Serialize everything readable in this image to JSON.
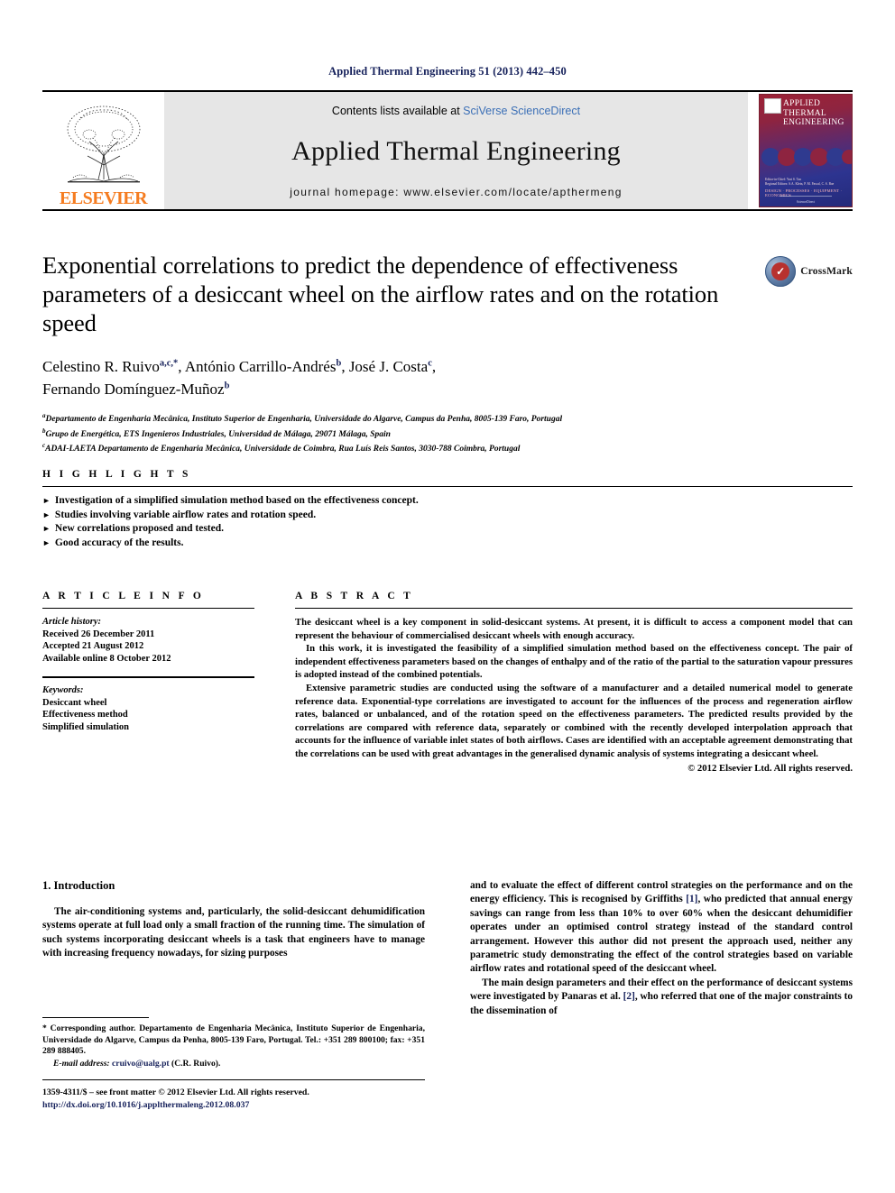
{
  "running_head": "Applied Thermal Engineering 51 (2013) 442–450",
  "masthead": {
    "contents_prefix": "Contents lists available at ",
    "contents_link": "SciVerse ScienceDirect",
    "journal_name": "Applied Thermal Engineering",
    "homepage": "journal homepage: www.elsevier.com/locate/apthermeng",
    "publisher_logo_text": "ELSEVIER",
    "cover": {
      "title_line1": "APPLIED",
      "title_line2": "THERMAL",
      "title_line3": "ENGINEERING",
      "authors_line": "Editor-in-Chief: Yuri S. Tan",
      "authors_line2": "Regional Editors: S.A. Klein, P. M. Pascal, C. S. Bae",
      "keywords_line": "DESIGN · PROCESSES · EQUIPMENT · ECONOMICS",
      "footer_text": "ScienceDirect"
    }
  },
  "article": {
    "title": "Exponential correlations to predict the dependence of effectiveness parameters of a desiccant wheel on the airflow rates and on the rotation speed",
    "crossmark_label": "CrossMark",
    "authors": [
      {
        "name": "Celestino R. Ruivo",
        "sup": "a,c,*"
      },
      {
        "name": "António Carrillo-Andrés",
        "sup": "b"
      },
      {
        "name": "José J. Costa",
        "sup": "c"
      },
      {
        "name": "Fernando Domínguez-Muñoz",
        "sup": "b"
      }
    ],
    "affiliations": [
      {
        "mark": "a",
        "text": "Departamento de Engenharia Mecânica, Instituto Superior de Engenharia, Universidade do Algarve, Campus da Penha, 8005-139 Faro, Portugal"
      },
      {
        "mark": "b",
        "text": "Grupo de Energética, ETS Ingenieros Industriales, Universidad de Málaga, 29071 Málaga, Spain"
      },
      {
        "mark": "c",
        "text": "ADAI-LAETA Departamento de Engenharia Mecânica, Universidade de Coimbra, Rua Luís Reis Santos, 3030-788 Coimbra, Portugal"
      }
    ]
  },
  "highlights": {
    "heading": "H I G H L I G H T S",
    "bullet_glyph": "►",
    "items": [
      "Investigation of a simplified simulation method based on the effectiveness concept.",
      "Studies involving variable airflow rates and rotation speed.",
      "New correlations proposed and tested.",
      "Good accuracy of the results."
    ]
  },
  "article_info": {
    "heading": "A R T I C L E   I N F O",
    "history_label": "Article history:",
    "history": [
      "Received 26 December 2011",
      "Accepted 21 August 2012",
      "Available online 8 October 2012"
    ],
    "keywords_label": "Keywords:",
    "keywords": [
      "Desiccant wheel",
      "Effectiveness method",
      "Simplified simulation"
    ]
  },
  "abstract": {
    "heading": "A B S T R A C T",
    "paragraphs": [
      "The desiccant wheel is a key component in solid-desiccant systems. At present, it is difficult to access a component model that can represent the behaviour of commercialised desiccant wheels with enough accuracy.",
      "In this work, it is investigated the feasibility of a simplified simulation method based on the effectiveness concept. The pair of independent effectiveness parameters based on the changes of enthalpy and of the ratio of the partial to the saturation vapour pressures is adopted instead of the combined potentials.",
      "Extensive parametric studies are conducted using the software of a manufacturer and a detailed numerical model to generate reference data. Exponential-type correlations are investigated to account for the influences of the process and regeneration airflow rates, balanced or unbalanced, and of the rotation speed on the effectiveness parameters. The predicted results provided by the correlations are compared with reference data, separately or combined with the recently developed interpolation approach that accounts for the influence of variable inlet states of both airflows. Cases are identified with an acceptable agreement demonstrating that the correlations can be used with great advantages in the generalised dynamic analysis of systems integrating a desiccant wheel."
    ],
    "copyright": "© 2012 Elsevier Ltd. All rights reserved."
  },
  "body": {
    "section_heading": "1. Introduction",
    "left_paragraph": "The air-conditioning systems and, particularly, the solid-desiccant dehumidification systems operate at full load only a small fraction of the running time. The simulation of such systems incorporating desiccant wheels is a task that engineers have to manage with increasing frequency nowadays, for sizing purposes",
    "right_paragraph_1a": "and to evaluate the effect of different control strategies on the performance and on the energy efficiency. This is recognised by Griffiths ",
    "right_cite_1": "[1]",
    "right_paragraph_1b": ", who predicted that annual energy savings can range from less than 10% to over 60% when the desiccant dehumidifier operates under an optimised control strategy instead of the standard control arrangement. However this author did not present the approach used, neither any parametric study demonstrating the effect of the control strategies based on variable airflow rates and rotational speed of the desiccant wheel.",
    "right_paragraph_2a": "The main design parameters and their effect on the performance of desiccant systems were investigated by Panaras et al. ",
    "right_cite_2": "[2]",
    "right_paragraph_2b": ", who referred that one of the major constraints to the dissemination of"
  },
  "footnote": {
    "corresponding": "* Corresponding author. Departamento de Engenharia Mecânica, Instituto Superior de Engenharia, Universidade do Algarve, Campus da Penha, 8005-139 Faro, Portugal. Tel.: +351 289 800100; fax: +351 289 888405.",
    "email_label": "E-mail address:",
    "email": "cruivo@ualg.pt",
    "email_owner": "(C.R. Ruivo)."
  },
  "footer": {
    "issn_line": "1359-4311/$ – see front matter © 2012 Elsevier Ltd. All rights reserved.",
    "doi": "http://dx.doi.org/10.1016/j.applthermaleng.2012.08.037"
  },
  "colors": {
    "link_blue": "#16215b",
    "sciencedirect_blue": "#3b6fb6",
    "elsevier_orange": "#f57c20",
    "masthead_grey": "#e6e6e6"
  }
}
